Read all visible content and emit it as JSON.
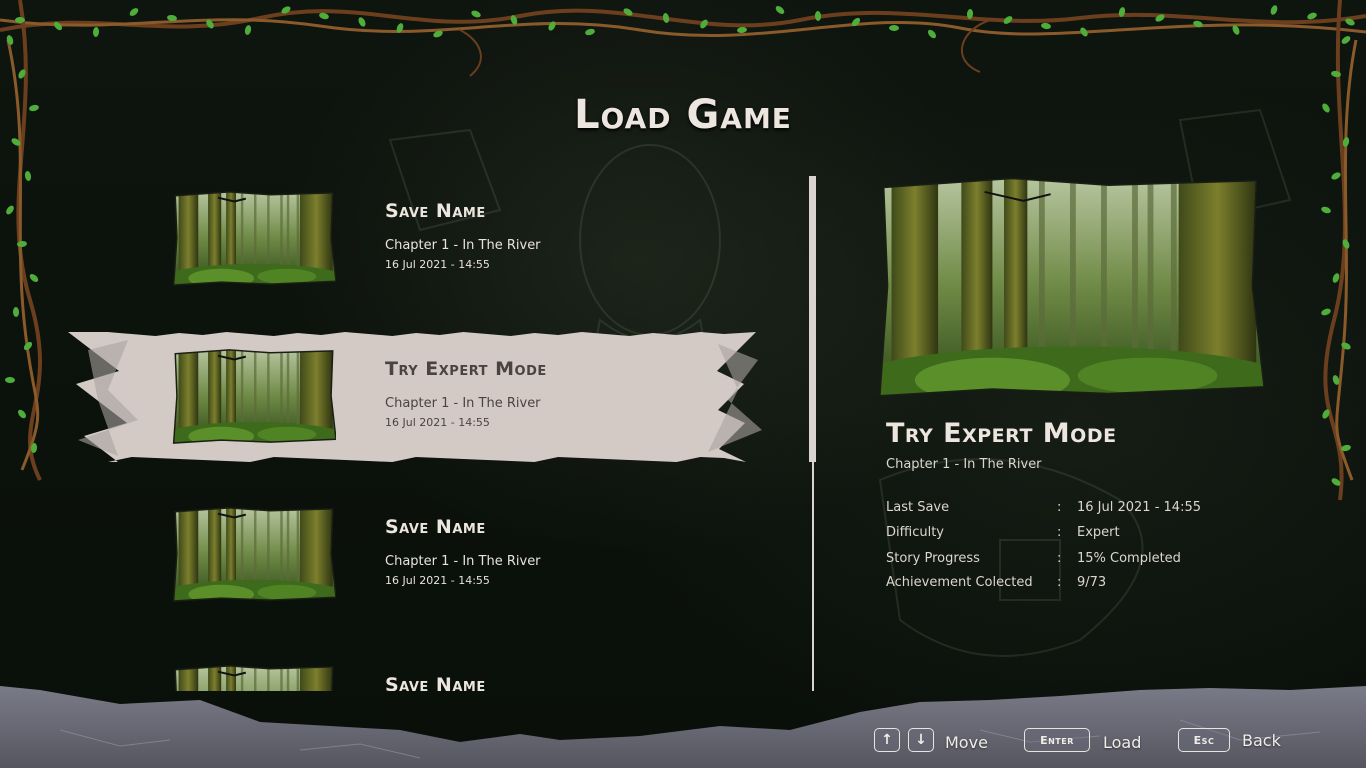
{
  "screen": {
    "title": "Load Game"
  },
  "saves": [
    {
      "name": "Save Name",
      "chapter": "Chapter 1 - In The River",
      "date": "16 Jul 2021 - 14:55",
      "selected": false
    },
    {
      "name": "Try Expert Mode",
      "chapter": "Chapter 1 - In The River",
      "date": "16 Jul 2021 - 14:55",
      "selected": true
    },
    {
      "name": "Save Name",
      "chapter": "Chapter 1 - In The River",
      "date": "16 Jul 2021 - 14:55",
      "selected": false
    },
    {
      "name": "Save Name",
      "chapter": "",
      "date": "",
      "selected": false
    }
  ],
  "detail": {
    "title": "Try Expert Mode",
    "chapter": "Chapter 1 - In The River",
    "separator": ":",
    "stats": [
      {
        "label": "Last Save",
        "value": "16 Jul 2021 - 14:55"
      },
      {
        "label": "Difficulty",
        "value": "Expert"
      },
      {
        "label": "Story Progress",
        "value": "15% Completed"
      },
      {
        "label": "Achievement Colected",
        "value": "9/73"
      }
    ]
  },
  "controls": {
    "up_key": "↑",
    "down_key": "↓",
    "move_label": "Move",
    "enter_key": "Enter",
    "load_label": "Load",
    "esc_key": "Esc",
    "back_label": "Back"
  },
  "colors": {
    "background": "#0b100b",
    "highlight": "#d3cac6",
    "text_light": "#ece6df",
    "text_dark": "#4a4340",
    "vine": "#6b3f1e",
    "leaf": "#4fae3b",
    "rock": "#6a6b78"
  },
  "scroll": {
    "thumb_fraction": 0.55,
    "position_fraction": 0
  }
}
